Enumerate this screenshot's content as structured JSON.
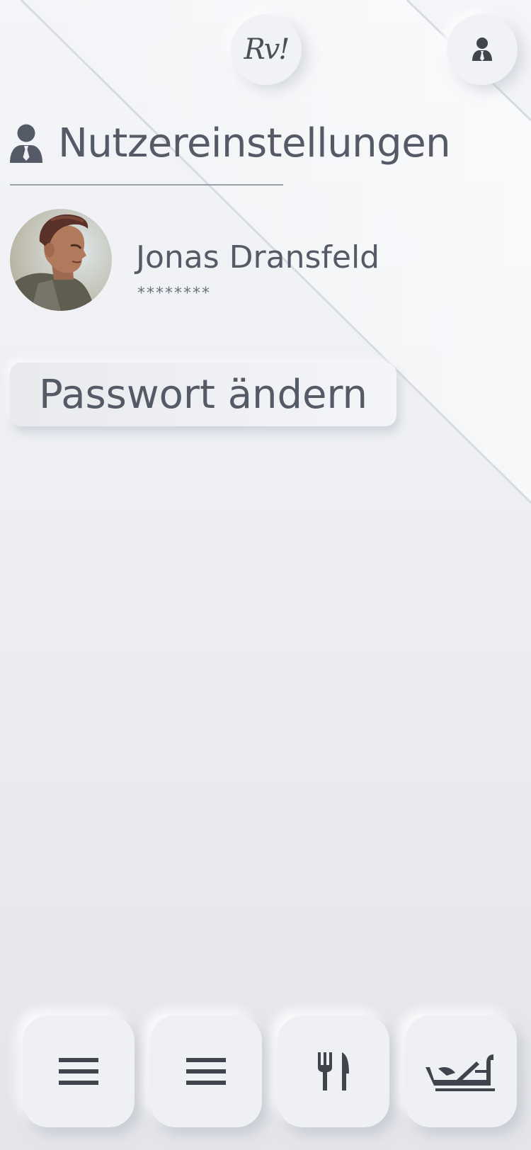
{
  "header": {
    "logo_text": "Rv!",
    "logo_icon": "restaurant-logo",
    "profile_icon": "user-tie-icon"
  },
  "settings": {
    "title": "Nutzereinstellungen",
    "title_icon": "user-tie-icon"
  },
  "user": {
    "name": "Jonas Dransfeld",
    "password_mask": "********",
    "avatar": "user-portrait"
  },
  "actions": {
    "change_password_label": "Passwort ändern"
  },
  "bottom_nav": {
    "items": [
      {
        "icon": "menu-icon"
      },
      {
        "icon": "menu-icon"
      },
      {
        "icon": "fork-knife-icon"
      },
      {
        "icon": "gondola-icon"
      }
    ]
  },
  "colors": {
    "text": "#545a66",
    "background": "#eceef2",
    "icon": "#3f444d"
  }
}
